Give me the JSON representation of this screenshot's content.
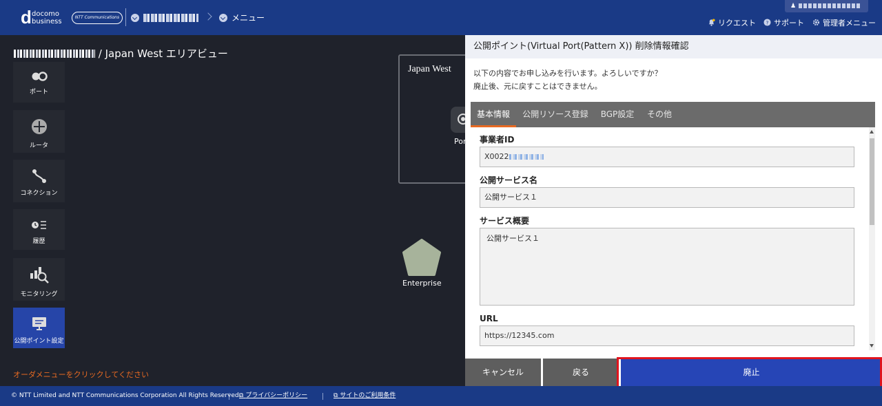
{
  "header": {
    "logo_d": "d",
    "logo_line1": "docomo",
    "logo_line2": "business",
    "ntt_badge": "NTT Communications",
    "menu_label": "メニュー",
    "links": {
      "request": "リクエスト",
      "support": "サポート",
      "admin_menu": "管理者メニュー"
    }
  },
  "page": {
    "title_suffix": "/ Japan West エリアビュー",
    "order_hint": "オーダメニューをクリックしてください"
  },
  "sidebar": {
    "items": [
      {
        "label": "ポート",
        "icon": "port-icon"
      },
      {
        "label": "ルータ",
        "icon": "router-icon"
      },
      {
        "label": "コネクション",
        "icon": "connection-icon"
      },
      {
        "label": "履歴",
        "icon": "history-icon"
      },
      {
        "label": "モニタリング",
        "icon": "monitoring-icon"
      },
      {
        "label": "公開ポイント設定",
        "icon": "public-point-icon",
        "active": true
      }
    ]
  },
  "canvas": {
    "area_title": "Japan West",
    "port_label": "Por",
    "enterprise_label": "Enterprise"
  },
  "modal": {
    "title": "公開ポイント(Virtual Port(Pattern X)) 削除情報確認",
    "message_line1": "以下の内容でお申し込みを行います。よろしいですか？",
    "message_line2": "廃止後、元に戻すことはできません。",
    "tabs": [
      {
        "label": "基本情報",
        "active": true
      },
      {
        "label": "公開リソース登録"
      },
      {
        "label": "BGP設定"
      },
      {
        "label": "その他"
      }
    ],
    "fields": {
      "operator_id_label": "事業者ID",
      "operator_id_value": "X0022",
      "service_name_label": "公開サービス名",
      "service_name_value": "公開サービス１",
      "service_summary_label": "サービス概要",
      "service_summary_value": "公開サービス１",
      "url_label": "URL",
      "url_value": "https://12345.com"
    },
    "buttons": {
      "cancel": "キャンセル",
      "back": "戻る",
      "abolish": "廃止"
    }
  },
  "footer": {
    "copyright": "© NTT Limited and NTT Communications Corporation All Rights Reserved.",
    "privacy": "プライバシーポリシー",
    "terms": "サイトのご利用条件"
  },
  "colors": {
    "header_bg": "#1a3a86",
    "active_blue": "#2645b6",
    "accent_orange": "#e86a22",
    "highlight_red": "#e0141e"
  }
}
